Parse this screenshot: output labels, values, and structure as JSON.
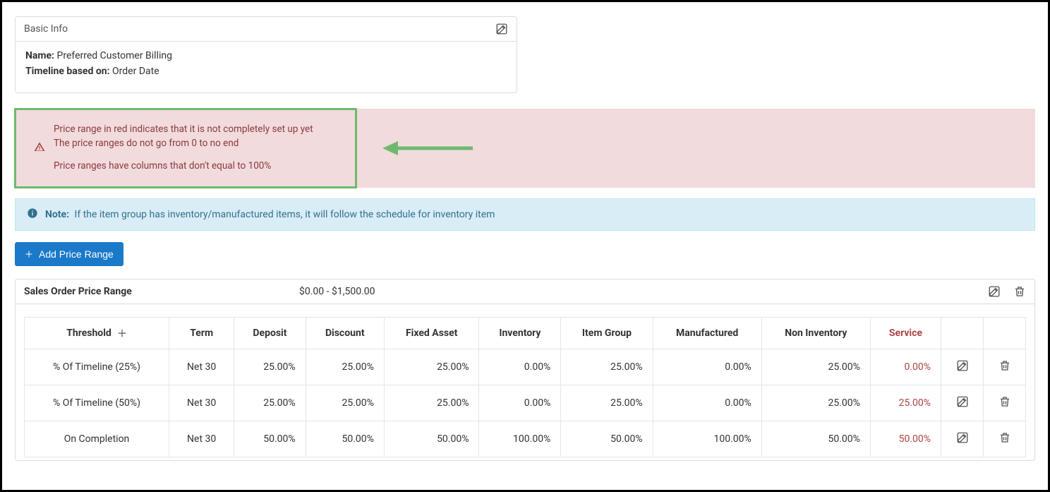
{
  "basicInfo": {
    "sectionTitle": "Basic Info",
    "nameLabel": "Name:",
    "nameValue": "Preferred Customer Billing",
    "timelineLabel": "Timeline based on:",
    "timelineValue": "Order Date"
  },
  "alertDanger": {
    "line1": "Price range in red indicates that it is not completely set up yet",
    "line2": "The price ranges do not go from 0 to no end",
    "line3": "Price ranges have columns that don't equal to 100%"
  },
  "alertInfo": {
    "label": "Note:",
    "text": "If the item group has inventory/manufactured items, it will follow the schedule for inventory item"
  },
  "addButton": {
    "label": "Add Price Range"
  },
  "panel": {
    "title": "Sales Order Price Range",
    "rangeText": "$0.00 - $1,500.00"
  },
  "table": {
    "headers": {
      "threshold": "Threshold",
      "term": "Term",
      "deposit": "Deposit",
      "discount": "Discount",
      "fixedAsset": "Fixed Asset",
      "inventory": "Inventory",
      "itemGroup": "Item Group",
      "manufactured": "Manufactured",
      "nonInventory": "Non Inventory",
      "service": "Service"
    },
    "rows": [
      {
        "threshold": "% Of Timeline (25%)",
        "term": "Net 30",
        "deposit": "25.00%",
        "discount": "25.00%",
        "fixedAsset": "25.00%",
        "inventory": "0.00%",
        "itemGroup": "25.00%",
        "manufactured": "0.00%",
        "nonInventory": "25.00%",
        "service": "0.00%"
      },
      {
        "threshold": "% Of Timeline (50%)",
        "term": "Net 30",
        "deposit": "25.00%",
        "discount": "25.00%",
        "fixedAsset": "25.00%",
        "inventory": "0.00%",
        "itemGroup": "25.00%",
        "manufactured": "0.00%",
        "nonInventory": "25.00%",
        "service": "25.00%"
      },
      {
        "threshold": "On Completion",
        "term": "Net 30",
        "deposit": "50.00%",
        "discount": "50.00%",
        "fixedAsset": "50.00%",
        "inventory": "100.00%",
        "itemGroup": "50.00%",
        "manufactured": "100.00%",
        "nonInventory": "50.00%",
        "service": "50.00%"
      }
    ]
  }
}
